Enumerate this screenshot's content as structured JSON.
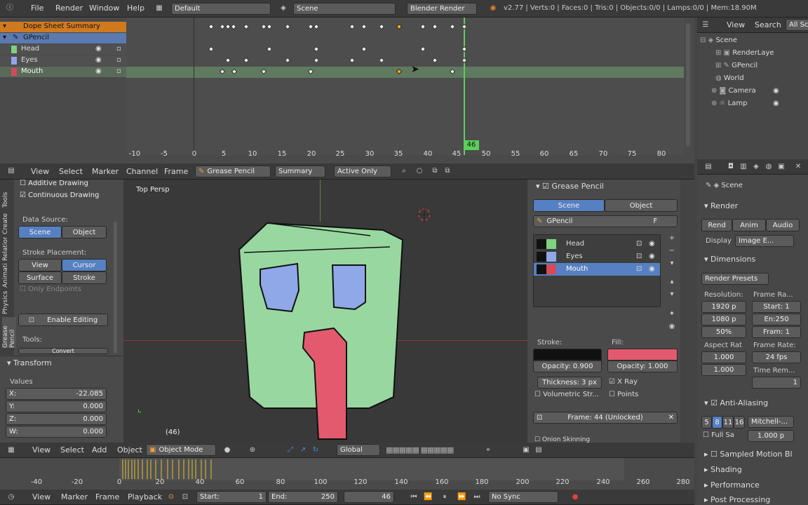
{
  "info_bar": {
    "menus": [
      "File",
      "Render",
      "Window",
      "Help"
    ],
    "layout": "Default",
    "scene": "Scene",
    "engine": "Blender Render",
    "stats": "v2.77 | Verts:0 | Faces:0 | Tris:0 | Objects:0/0 | Lamps:0/0 | Mem:18.90M"
  },
  "dopesheet": {
    "channels": [
      {
        "label": "Dope Sheet Summary",
        "kind": "summary"
      },
      {
        "label": "GPencil",
        "kind": "object"
      },
      {
        "label": "Head",
        "kind": "layer",
        "color": "#7fd27f"
      },
      {
        "label": "Eyes",
        "kind": "layer",
        "color": "#8fa8e8"
      },
      {
        "label": "Mouth",
        "kind": "layer",
        "color": "#d64a5a"
      }
    ],
    "ruler": [
      "-10",
      "-5",
      "0",
      "5",
      "10",
      "15",
      "20",
      "25",
      "30",
      "35",
      "40",
      "45",
      "50",
      "55",
      "60",
      "65",
      "70",
      "75",
      "80"
    ],
    "current_frame": "46",
    "header": {
      "menus": [
        "View",
        "Select",
        "Marker",
        "Channel",
        "Frame"
      ],
      "mode": "Grease Pencil",
      "summary": "Summary",
      "active_only": "Active Only"
    }
  },
  "outliner": {
    "header": [
      "View",
      "Search",
      "All Sc"
    ],
    "items": [
      "Scene",
      "RenderLaye",
      "GPencil",
      "World",
      "Camera",
      "Lamp"
    ]
  },
  "tool_shelf": {
    "additive": "Additive Drawing",
    "continuous": "Continuous Drawing",
    "data_source": "Data Source:",
    "scene": "Scene",
    "object": "Object",
    "stroke_placement": "Stroke Placement:",
    "view": "View",
    "cursor": "Cursor",
    "surface": "Surface",
    "stroke": "Stroke",
    "only_endpoints": "Only Endpoints",
    "enable_editing": "Enable Editing",
    "tools": "Tools:",
    "convert": "Convert",
    "tabs": [
      "Tools",
      "Create",
      "Relations",
      "Animation",
      "Physics",
      "Grease Pencil"
    ]
  },
  "transform": {
    "title": "Transform",
    "values": "Values",
    "x": "-22.085",
    "y": "0.000",
    "z": "0.000",
    "w": "0.000",
    "x_label": "X:",
    "y_label": "Y:",
    "z_label": "Z:",
    "w_label": "W:"
  },
  "viewport": {
    "title": "Top Persp",
    "frame": "(46)",
    "header": {
      "menus": [
        "View",
        "Select",
        "Add",
        "Object"
      ],
      "mode": "Object Mode",
      "orientation": "Global"
    }
  },
  "gp_panel": {
    "title": "Grease Pencil",
    "scene": "Scene",
    "object": "Object",
    "datablock": "GPencil",
    "fake": "F",
    "layers": [
      {
        "name": "Head",
        "color": "#7fd27f"
      },
      {
        "name": "Eyes",
        "color": "#8fa8e8"
      },
      {
        "name": "Mouth",
        "color": "#d64a5a"
      }
    ],
    "stroke": "Stroke:",
    "fill": "Fill:",
    "stroke_opacity": "Opacity:  0.900",
    "fill_opacity": "Opacity:  1.000",
    "fill_color": "#e35a6e",
    "thickness": "Thickness:  3 px",
    "xray": "X Ray",
    "volumetric": "Volumetric Str...",
    "points": "Points",
    "frame": "Frame: 44 (Unlocked)",
    "onion": "Onion Skinning"
  },
  "properties": {
    "breadcrumb": "Scene",
    "render": "Render",
    "render_btn": "Rend",
    "anim_btn": "Anim",
    "audio_btn": "Audio",
    "display": "Display",
    "display_val": "Image E...",
    "dimensions": "Dimensions",
    "presets": "Render Presets",
    "resolution": "Resolution:",
    "res_x": "1920 p",
    "res_y": "1080 p",
    "res_pct": "50%",
    "frame_range": "Frame Ra...",
    "start": "Start: 1",
    "end": "En:250",
    "step": "Fram: 1",
    "aspect": "Aspect Rat",
    "aspect_x": "1.000",
    "aspect_y": "1.000",
    "frame_rate": "Frame Rate:",
    "fps": "24 fps",
    "time_rem": "Time Rem...",
    "time_val": "1",
    "aa": "Anti-Aliasing",
    "aa_samples": [
      "5",
      "8",
      "11",
      "16"
    ],
    "filter": "Mitchell-...",
    "full_sample": "Full Sa",
    "filter_size": "1.000 p",
    "sampled_motion": "Sampled Motion Bl",
    "shading": "Shading",
    "performance": "Performance",
    "post": "Post Processing"
  },
  "timeline": {
    "ruler": [
      "-40",
      "-20",
      "0",
      "20",
      "40",
      "60",
      "80",
      "100",
      "120",
      "140",
      "160",
      "180",
      "200",
      "220",
      "240",
      "260",
      "280"
    ],
    "menus": [
      "View",
      "Marker",
      "Frame",
      "Playback"
    ],
    "start": "Start:",
    "start_val": "1",
    "end": "End:",
    "end_val": "250",
    "current": "46",
    "sync": "No Sync"
  }
}
